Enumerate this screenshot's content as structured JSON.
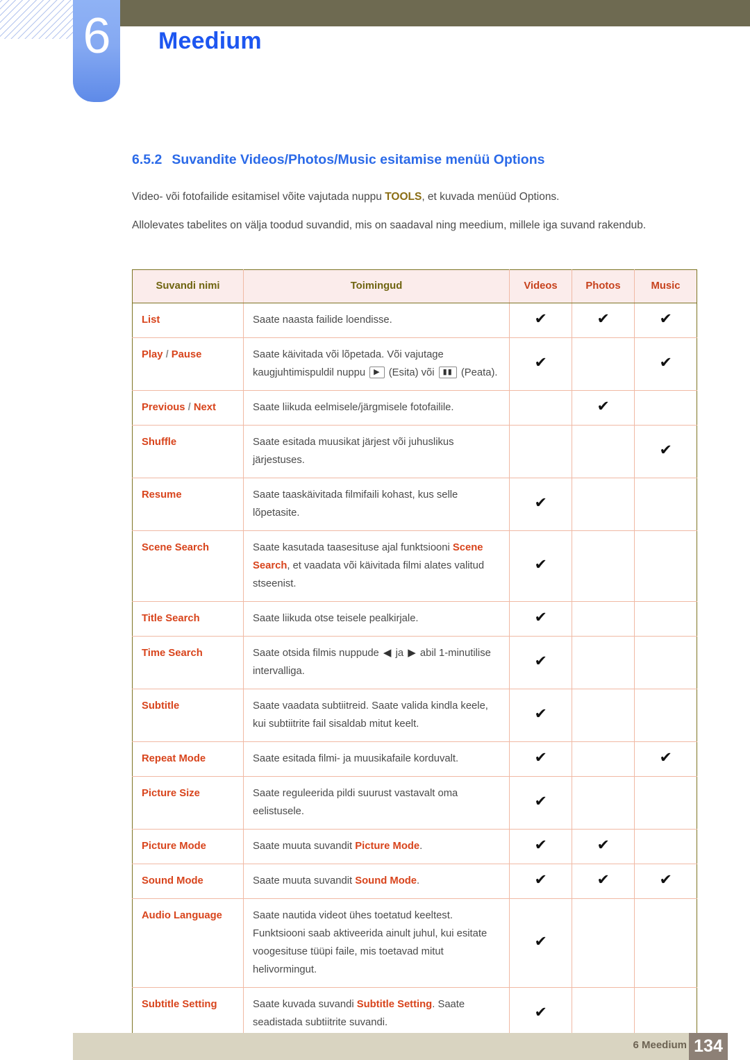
{
  "header": {
    "chapter_number": "6",
    "chapter_title": "Meedium"
  },
  "section": {
    "number": "6.5.2",
    "title": "Suvandite Videos/Photos/Music esitamise menüü Options"
  },
  "paragraphs": {
    "p1_before": "Video- või fotofailide esitamisel võite vajutada nuppu ",
    "p1_key": "TOOLS",
    "p1_after": ", et kuvada menüüd Options.",
    "p2": "Allolevates tabelites on välja toodud suvandid, mis on saadaval ning meedium, millele iga suvand rakendub."
  },
  "table": {
    "headers": [
      "Suvandi nimi",
      "Toimingud",
      "Videos",
      "Photos",
      "Music"
    ],
    "check_glyph": "✔",
    "rows": [
      {
        "name": "List",
        "name_parts": [
          {
            "t": "List",
            "b": true
          }
        ],
        "action": "Saate naasta failide loendisse.",
        "videos": true,
        "photos": true,
        "music": true
      },
      {
        "name": "Play / Pause",
        "name_parts": [
          {
            "t": "Play",
            "b": true
          },
          {
            "t": " / ",
            "b": false
          },
          {
            "t": "Pause",
            "b": true
          }
        ],
        "action": "Saate käivitada või lõpetada. Või vajutage kaugjuhtimispuldil nuppu ▶ (Esita) või ▮▮ (Peata).",
        "action_segments": [
          {
            "type": "text",
            "t": "Saate käivitada või lõpetada. Või vajutage kaugjuhtimispuldil nuppu "
          },
          {
            "type": "key",
            "t": "▶",
            "icon": "play-key-icon"
          },
          {
            "type": "text",
            "t": " (Esita) või "
          },
          {
            "type": "key",
            "t": "▮▮",
            "icon": "pause-key-icon"
          },
          {
            "type": "text",
            "t": " (Peata)."
          }
        ],
        "videos": true,
        "photos": false,
        "music": true
      },
      {
        "name": "Previous / Next",
        "name_parts": [
          {
            "t": "Previous",
            "b": true
          },
          {
            "t": " / ",
            "b": false
          },
          {
            "t": "Next",
            "b": true
          }
        ],
        "action": "Saate liikuda eelmisele/järgmisele fotofailile.",
        "videos": false,
        "photos": true,
        "music": false
      },
      {
        "name": "Shuffle",
        "name_parts": [
          {
            "t": "Shuffle",
            "b": true
          }
        ],
        "action": "Saate esitada muusikat järjest või juhuslikus järjestuses.",
        "videos": false,
        "photos": false,
        "music": true
      },
      {
        "name": "Resume",
        "name_parts": [
          {
            "t": "Resume",
            "b": true
          }
        ],
        "action": "Saate taaskäivitada filmifaili kohast, kus selle lõpetasite.",
        "videos": true,
        "photos": false,
        "music": false
      },
      {
        "name": "Scene Search",
        "name_parts": [
          {
            "t": "Scene Search",
            "b": true
          }
        ],
        "action": "Saate kasutada taasesituse ajal funktsiooni Scene Search, et vaadata või käivitada filmi alates valitud stseenist.",
        "action_segments": [
          {
            "type": "text",
            "t": "Saate kasutada taasesituse ajal funktsiooni "
          },
          {
            "type": "bold",
            "t": "Scene Search"
          },
          {
            "type": "text",
            "t": ", et vaadata või käivitada filmi alates valitud stseenist."
          }
        ],
        "videos": true,
        "photos": false,
        "music": false
      },
      {
        "name": "Title Search",
        "name_parts": [
          {
            "t": "Title Search",
            "b": true
          }
        ],
        "action": "Saate liikuda otse teisele pealkirjale.",
        "videos": true,
        "photos": false,
        "music": false
      },
      {
        "name": "Time Search",
        "name_parts": [
          {
            "t": "Time Search",
            "b": true
          }
        ],
        "action": "Saate otsida filmis nuppude ◀ ja ▶ abil 1-minutilise intervalliga.",
        "action_segments": [
          {
            "type": "text",
            "t": "Saate otsida filmis nuppude "
          },
          {
            "type": "arrow",
            "t": "◀",
            "icon": "arrow-left-icon"
          },
          {
            "type": "text",
            "t": " ja "
          },
          {
            "type": "arrow",
            "t": "▶",
            "icon": "arrow-right-icon"
          },
          {
            "type": "text",
            "t": " abil 1-minutilise intervalliga."
          }
        ],
        "videos": true,
        "photos": false,
        "music": false
      },
      {
        "name": "Subtitle",
        "name_parts": [
          {
            "t": "Subtitle",
            "b": true
          }
        ],
        "action": "Saate vaadata subtiitreid. Saate valida kindla keele, kui subtiitrite fail sisaldab mitut keelt.",
        "videos": true,
        "photos": false,
        "music": false
      },
      {
        "name": "Repeat Mode",
        "name_parts": [
          {
            "t": "Repeat Mode",
            "b": true
          }
        ],
        "action": "Saate esitada filmi- ja muusikafaile korduvalt.",
        "videos": true,
        "photos": false,
        "music": true
      },
      {
        "name": "Picture Size",
        "name_parts": [
          {
            "t": "Picture Size",
            "b": true
          }
        ],
        "action": "Saate reguleerida pildi suurust vastavalt oma eelistusele.",
        "videos": true,
        "photos": false,
        "music": false
      },
      {
        "name": "Picture Mode",
        "name_parts": [
          {
            "t": "Picture Mode",
            "b": true
          }
        ],
        "action": "Saate muuta suvandit Picture Mode.",
        "action_segments": [
          {
            "type": "text",
            "t": "Saate muuta suvandit "
          },
          {
            "type": "bold",
            "t": "Picture Mode"
          },
          {
            "type": "text",
            "t": "."
          }
        ],
        "videos": true,
        "photos": true,
        "music": false
      },
      {
        "name": "Sound Mode",
        "name_parts": [
          {
            "t": "Sound Mode",
            "b": true
          }
        ],
        "action": "Saate muuta suvandit Sound Mode.",
        "action_segments": [
          {
            "type": "text",
            "t": "Saate muuta suvandit "
          },
          {
            "type": "bold",
            "t": "Sound Mode"
          },
          {
            "type": "text",
            "t": "."
          }
        ],
        "videos": true,
        "photos": true,
        "music": true
      },
      {
        "name": "Audio Language",
        "name_parts": [
          {
            "t": "Audio Language",
            "b": true
          }
        ],
        "action": "Saate nautida videot ühes toetatud keeltest. Funktsiooni saab aktiveerida ainult juhul, kui esitate voogesituse tüüpi faile, mis toetavad mitut helivormingut.",
        "videos": true,
        "photos": false,
        "music": false
      },
      {
        "name": "Subtitle Setting",
        "name_parts": [
          {
            "t": "Subtitle Setting",
            "b": true
          }
        ],
        "action": "Saate kuvada suvandi Subtitle Setting. Saate seadistada subtiitrite suvandi.",
        "action_segments": [
          {
            "type": "text",
            "t": "Saate kuvada suvandi "
          },
          {
            "type": "bold",
            "t": "Subtitle Setting"
          },
          {
            "type": "text",
            "t": ". Saate seadistada subtiitrite suvandi."
          }
        ],
        "videos": true,
        "photos": false,
        "music": false
      }
    ]
  },
  "footer": {
    "label": "6 Meedium",
    "page": "134"
  },
  "colors": {
    "accent_blue": "#2b6ae8",
    "chapter_blue": "#1d56f0",
    "term_orange": "#d8441c",
    "header_olive": "#6f6410",
    "topbar_olive": "#6e6a51",
    "footer_beige": "#d9d4c1",
    "page_box": "#8d8076"
  }
}
